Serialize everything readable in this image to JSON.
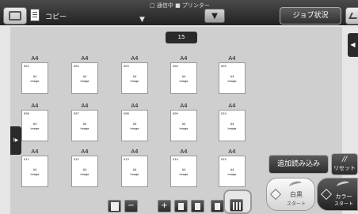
{
  "header": {
    "app_title": "コピー",
    "title_dropdown_glyph": "▼",
    "legend_outline_label": "□ 通信中",
    "legend_filled_label": "■ プリンター",
    "dropdown_glyph": "▼",
    "job_status_label": "ジョブ状況"
  },
  "preview": {
    "page_count": "15",
    "thumbnails": [
      {
        "size": "A4",
        "num": "001",
        "a4": "A4",
        "image": "image"
      },
      {
        "size": "A4",
        "num": "002",
        "a4": "A4",
        "image": "image"
      },
      {
        "size": "A4",
        "num": "003",
        "a4": "A4",
        "image": "image"
      },
      {
        "size": "A4",
        "num": "004",
        "a4": "A4",
        "image": "image"
      },
      {
        "size": "A4",
        "num": "005",
        "a4": "A4",
        "image": "image"
      },
      {
        "size": "A4",
        "num": "006",
        "a4": "A4",
        "image": "image"
      },
      {
        "size": "A4",
        "num": "007",
        "a4": "A4",
        "image": "image"
      },
      {
        "size": "A4",
        "num": "008",
        "a4": "A4",
        "image": "image"
      },
      {
        "size": "A4",
        "num": "009",
        "a4": "A4",
        "image": "image"
      },
      {
        "size": "A4",
        "num": "010",
        "a4": "A4",
        "image": "image"
      },
      {
        "size": "A4",
        "num": "011",
        "a4": "A4",
        "image": "image"
      },
      {
        "size": "A4",
        "num": "012",
        "a4": "A4",
        "image": "image"
      },
      {
        "size": "A4",
        "num": "013",
        "a4": "A4",
        "image": "image"
      },
      {
        "size": "A4",
        "num": "014",
        "a4": "A4",
        "image": "image"
      },
      {
        "size": "A4",
        "num": "015",
        "a4": "A4",
        "image": "image"
      }
    ],
    "left_handle_glyph": "I▶",
    "right_handle_glyph": "◀"
  },
  "actions": {
    "add_scan_label": "追加読み込み",
    "reset_symbol": "//",
    "reset_label": "リセット",
    "bw_start_label": "白黒",
    "bw_start_sub": "スタート",
    "color_start_label": "カラー",
    "color_start_sub": "スタート"
  },
  "toolbar": {
    "minus_glyph": "−",
    "plus_glyph": "+"
  }
}
